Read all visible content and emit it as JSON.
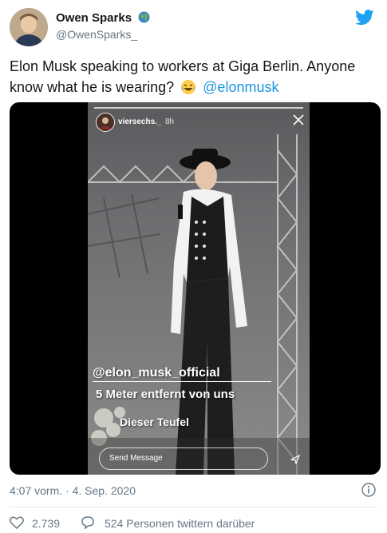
{
  "author": {
    "name": "Owen Sparks",
    "handle": "@OwenSparks_",
    "badge_icon": "globe-emoji-icon"
  },
  "tweet": {
    "text_prefix": "Elon Musk speaking to workers at Giga Berlin. Anyone know what he is wearing?",
    "emoji_icon": "laughing-tears-emoji-icon",
    "mention": "@elonmusk",
    "mention_color": "#1b95e0"
  },
  "media": {
    "story_user": "viersechs._",
    "story_time": "8h",
    "overlay_mention": "@elon_musk_official",
    "overlay_line2": "5 Meter entfernt von uns",
    "overlay_line3": "Dieser Teufel",
    "send_placeholder": "Send Message"
  },
  "meta": {
    "timestamp": "4:07 vorm. · 4. Sep. 2020",
    "likes": "2.739",
    "talking": "524 Personen twittern darüber"
  },
  "colors": {
    "text": "#14171a",
    "secondary": "#657786",
    "brand": "#1da1f2"
  }
}
